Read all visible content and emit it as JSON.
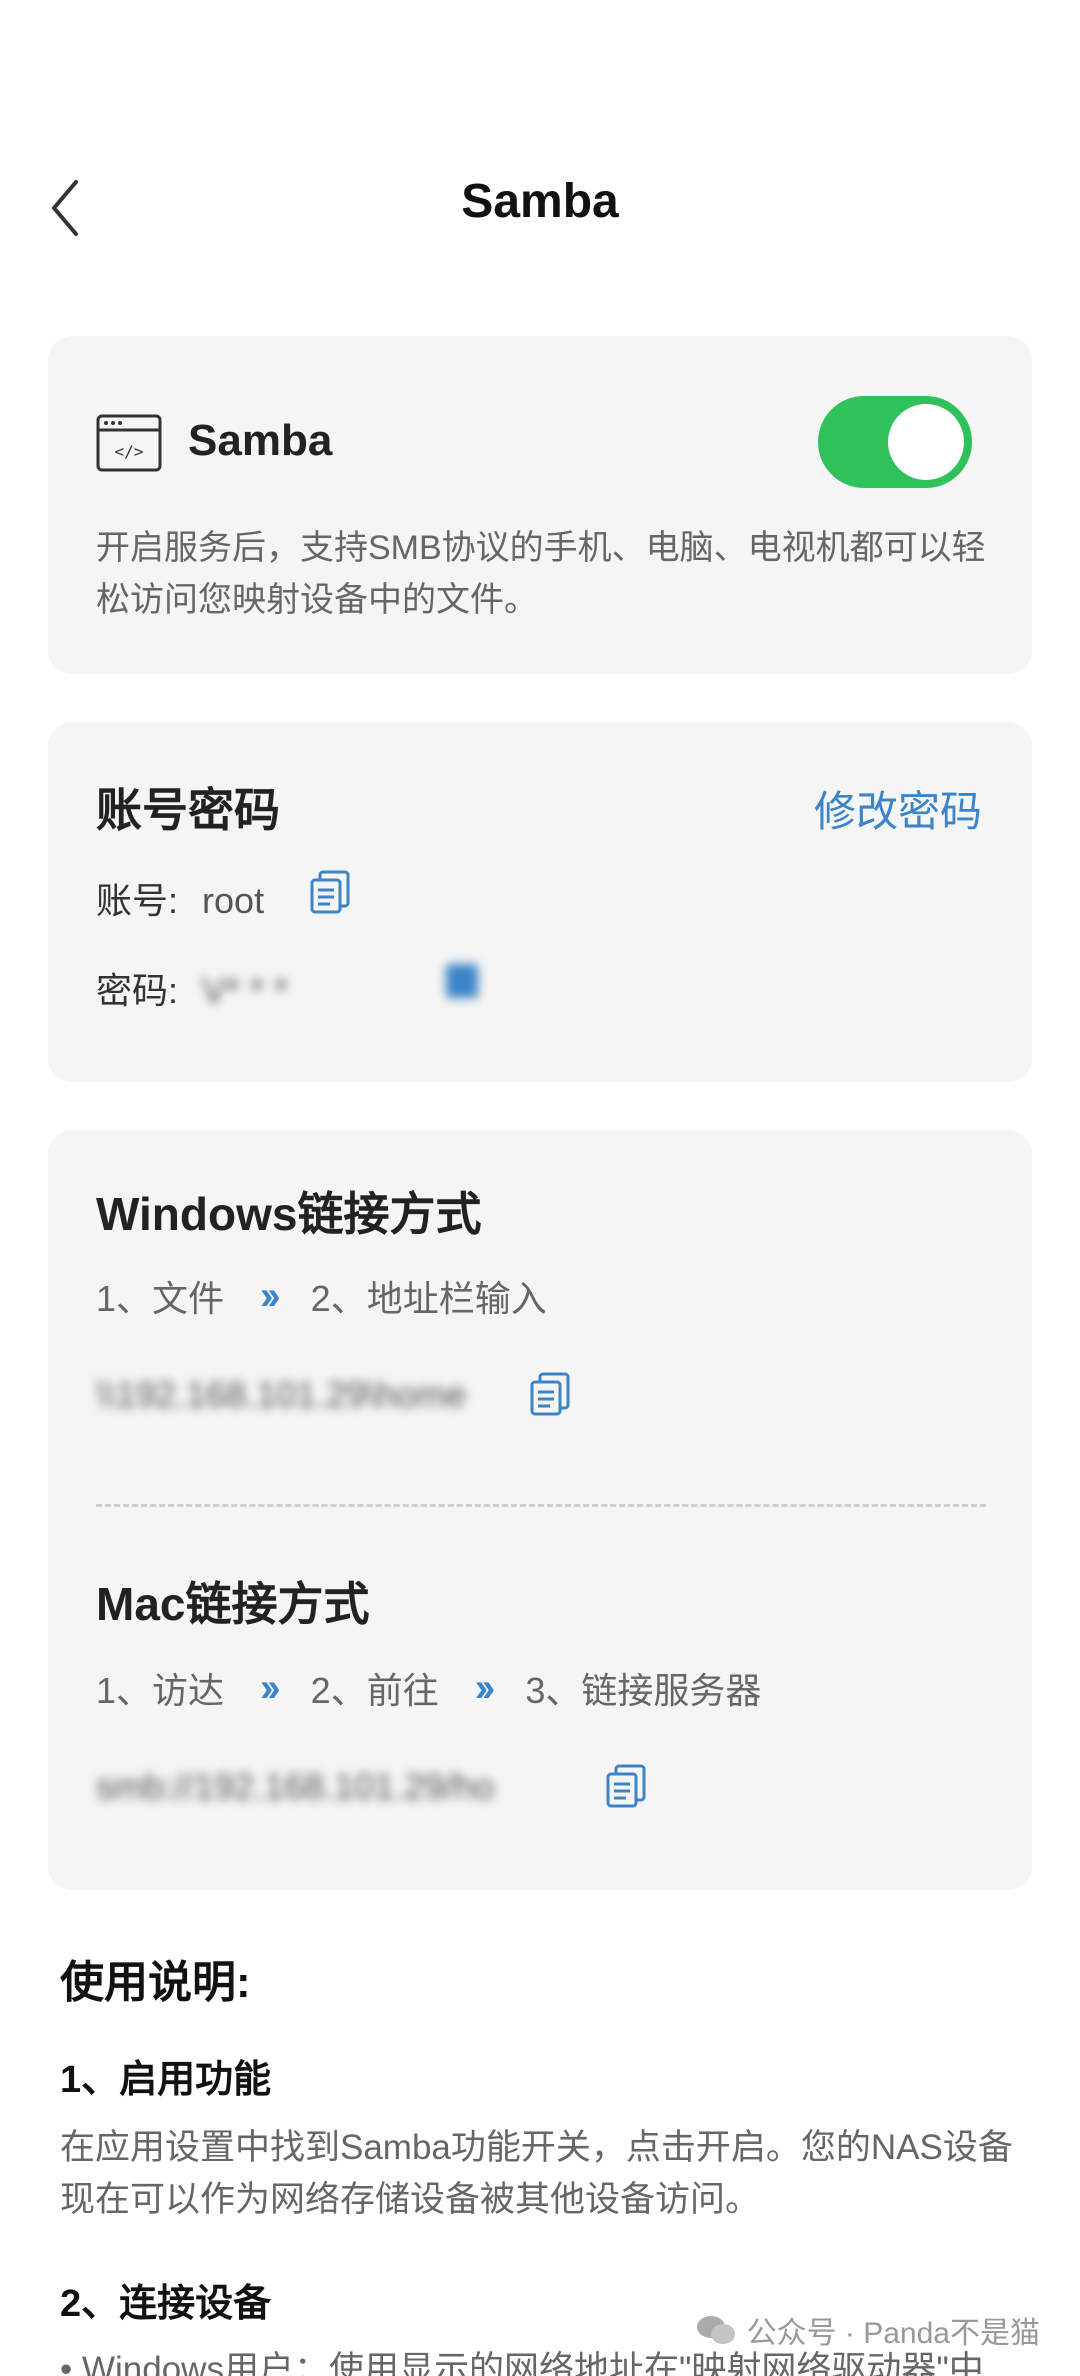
{
  "header": {
    "title": "Samba"
  },
  "samba_card": {
    "title": "Samba",
    "enabled": true,
    "description": "开启服务后，支持SMB协议的手机、电脑、电视机都可以轻松访问您映射设备中的文件。"
  },
  "account_card": {
    "title": "账号密码",
    "edit_label": "修改密码",
    "account_label": "账号:",
    "account_value": "root",
    "password_label": "密码:",
    "password_value": "V*  *   *"
  },
  "connect_card": {
    "windows_title": "Windows链接方式",
    "windows_steps": [
      "1、文件",
      "2、地址栏输入"
    ],
    "windows_address": "\\\\192.168.101.29\\home",
    "mac_title": "Mac链接方式",
    "mac_steps": [
      "1、访达",
      "2、前往",
      "3、链接服务器"
    ],
    "mac_address": "smb://192.168.101.29/ho"
  },
  "usage": {
    "title": "使用说明:",
    "step1_title": "1、启用功能",
    "step1_text": "在应用设置中找到Samba功能开关，点击开启。您的NAS设备现在可以作为网络存储设备被其他设备访问。",
    "step2_title": "2、连接设备",
    "step2_text": "• Windows用户：使用显示的网络地址在\"映射网络驱动器\"中"
  },
  "watermark": {
    "text": "公众号 · Panda不是猫"
  },
  "colors": {
    "accent": "#3b84c8",
    "toggle_on": "#2fc25b",
    "card_bg": "#f5f5f5"
  }
}
